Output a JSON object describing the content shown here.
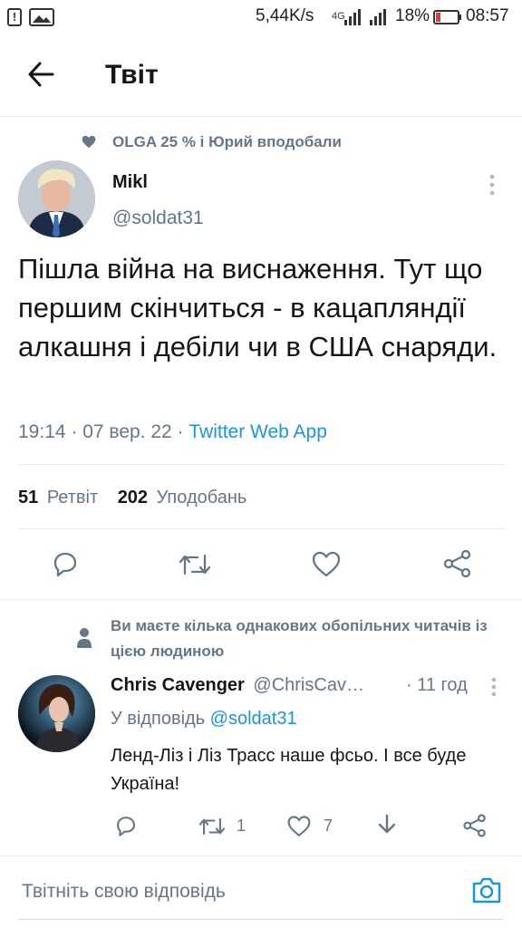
{
  "status_bar": {
    "speed": "5,44K/s",
    "network": "4G",
    "battery": "18%",
    "time": "08:57"
  },
  "header": {
    "title": "Твіт"
  },
  "social_context": {
    "text": "OLGA 25 % і Юрий вподобали"
  },
  "tweet": {
    "author_name": "Mikl",
    "author_handle": "@soldat31",
    "text": "Пішла війна на виснаження. Тут що першим скінчиться - в кацапляндії алкашня і дебіли чи в США снаряди.",
    "time": "19:14 · 07 вер. 22 · ",
    "source": "Twitter Web App",
    "retweets_count": "51",
    "retweets_label": "Ретвіт",
    "likes_count": "202",
    "likes_label": "Уподобань"
  },
  "reply_context": {
    "text": "Ви маєте кілька однакових обопільних читачів із цією людиною"
  },
  "reply": {
    "author_name": "Chris Cavenger",
    "author_handle": "@ChrisCav…",
    "time": "· 11 год",
    "replying_to_label": "У відповідь ",
    "replying_to_handle": "@soldat31",
    "text": "Ленд-Ліз і Ліз Трасс наше фсьо. І все буде Україна!",
    "retweets": "1",
    "likes": "7"
  },
  "compose": {
    "placeholder": "Твітніть свою відповідь"
  },
  "colors": {
    "accent": "#1b95e0",
    "muted": "#657786",
    "text": "#14171a",
    "divider": "#e6ecf0"
  }
}
